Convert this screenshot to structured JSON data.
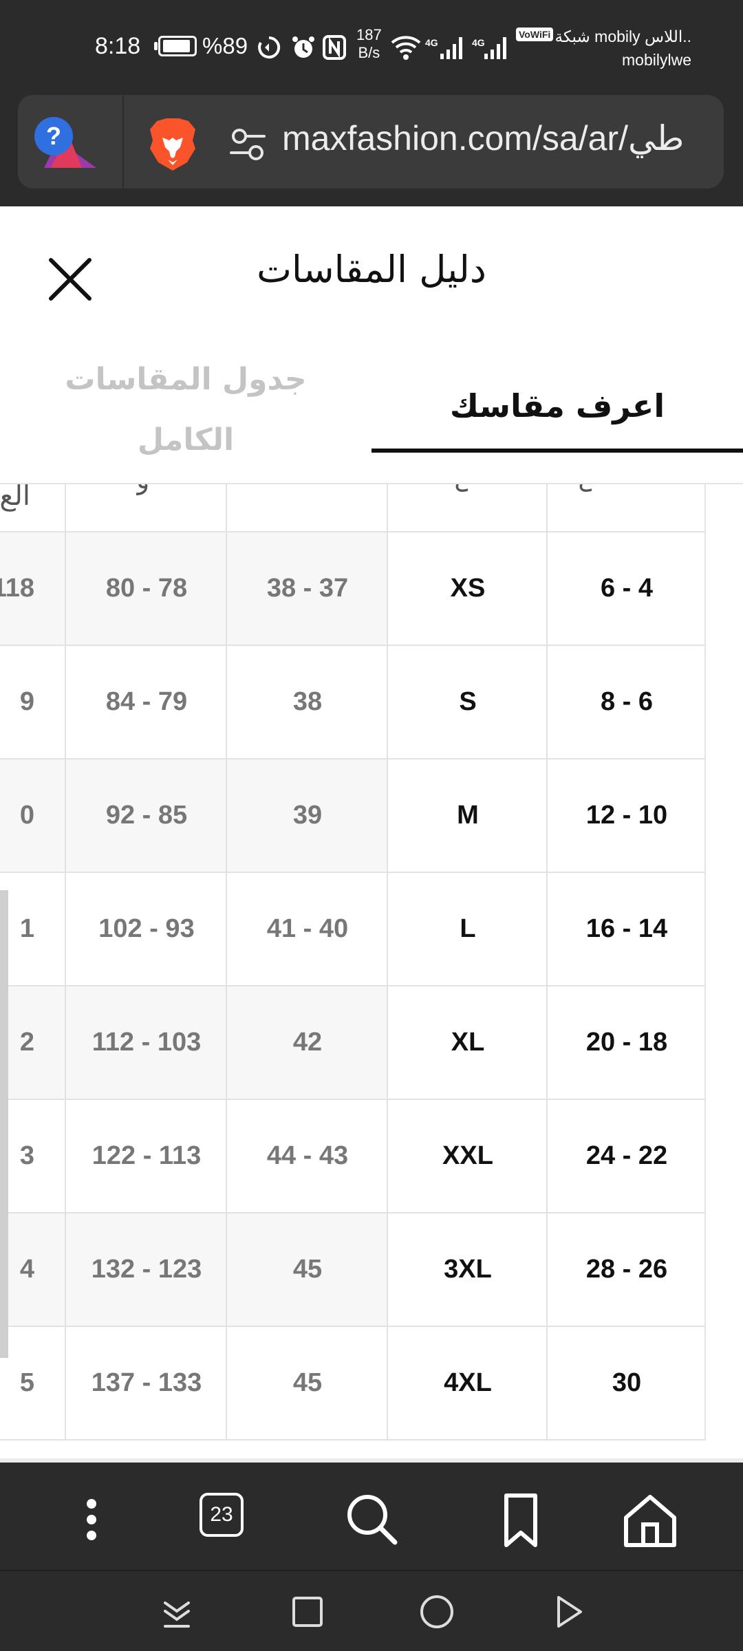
{
  "status_bar": {
    "time": "8:18",
    "battery_percent": "%89",
    "battery_level": 0.89,
    "net_speed_value": "187",
    "net_speed_unit": "B/s",
    "signal_1_label": "4G",
    "signal_2_label": "4G",
    "vowifi": "VoWiFi",
    "carrier_line1": "شبكة mobily اللاس..",
    "carrier_line2": "mobilylwe"
  },
  "address_bar": {
    "url": "maxfashion.com/sa/ar/طي"
  },
  "sheet": {
    "title": "دليل المقاسات",
    "tabs": {
      "full_chart": "جدول المقاسات الكامل",
      "know_your_size": "اعرف مقاسك"
    },
    "table_rows": [
      {
        "age": "6 - 4",
        "size": "XS",
        "shoe": "38 - 37",
        "chest": "80 - 78",
        "cut": "118"
      },
      {
        "age": "8 - 6",
        "size": "S",
        "shoe": "38",
        "chest": "84 - 79",
        "cut": "9"
      },
      {
        "age": "12 - 10",
        "size": "M",
        "shoe": "39",
        "chest": "92 - 85",
        "cut": "0"
      },
      {
        "age": "16 - 14",
        "size": "L",
        "shoe": "41 - 40",
        "chest": "102 - 93",
        "cut": "1"
      },
      {
        "age": "20 - 18",
        "size": "XL",
        "shoe": "42",
        "chest": "112 - 103",
        "cut": "2"
      },
      {
        "age": "24 - 22",
        "size": "XXL",
        "shoe": "44 - 43",
        "chest": "122 - 113",
        "cut": "3"
      },
      {
        "age": "28 - 26",
        "size": "3XL",
        "shoe": "45",
        "chest": "132 - 123",
        "cut": "4"
      },
      {
        "age": "30",
        "size": "4XL",
        "shoe": "45",
        "chest": "137 - 133",
        "cut": "5"
      }
    ],
    "header_fragment": "الع"
  },
  "toolbar": {
    "tabs_count": "23"
  },
  "colors": {
    "chrome_bg": "#2b2b2b",
    "url_field_bg": "#3b3b3b",
    "brave_orange": "#fb542b",
    "tab_active": "#111111",
    "tab_inactive": "#c4c4c4",
    "cell_muted": "#777777",
    "cell_shade": "#f7f7f7"
  },
  "icons": {
    "close": "close-icon",
    "brave": "brave-lion-icon",
    "site_settings": "tune-icon",
    "menu": "more-vert-icon",
    "search": "search-icon",
    "bookmark": "bookmark-icon",
    "home": "home-icon"
  }
}
